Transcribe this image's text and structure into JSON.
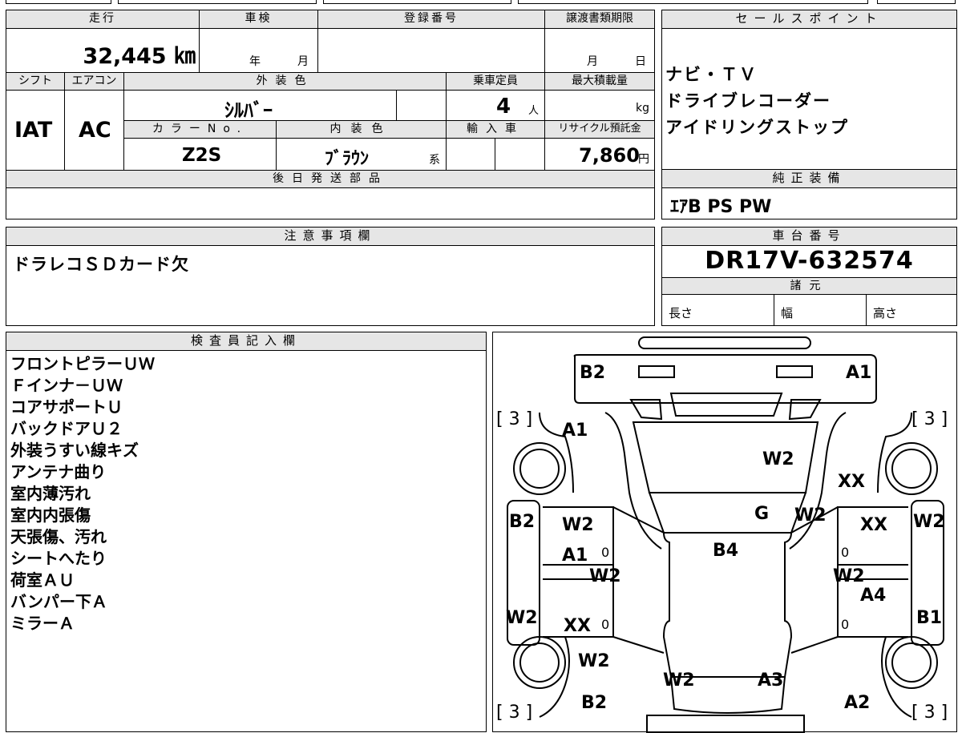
{
  "top_info": {
    "mileage_label": "走行",
    "mileage_value": "32,445 ㎞",
    "shaken_label": "車検",
    "shaken_year_unit": "年",
    "shaken_month_unit": "月",
    "reg_number_label": "登録番号",
    "transfer_docs_label": "譲渡書類期限",
    "transfer_month_unit": "月",
    "transfer_day_unit": "日",
    "shift_label": "シフト",
    "shift_value": "IAT",
    "aircon_label": "エアコン",
    "aircon_value": "AC",
    "exterior_color_label": "外装色",
    "exterior_color_value": "ｼﾙﾊﾞｰ",
    "capacity_label": "乗車定員",
    "capacity_value": "4",
    "capacity_unit": "人",
    "max_load_label": "最大積載量",
    "max_load_unit": "kg",
    "color_no_label": "カラーNo.",
    "color_no_value": "Z2S",
    "interior_color_label": "内装色",
    "interior_color_value": "ﾌﾞﾗｳﾝ",
    "interior_color_suffix": "系",
    "import_label": "輸入車",
    "recycle_label": "リサイクル預託金",
    "recycle_value": "7,860",
    "recycle_unit": "円",
    "later_parts_label": "後日発送部品"
  },
  "sales_points": {
    "label": "セールスポイント",
    "items": [
      "ナビ・ＴＶ",
      "ドライブレコーダー",
      "アイドリングストップ"
    ]
  },
  "factory_equipment": {
    "label": "純正装備",
    "value": "ｴｱB PS PW"
  },
  "notes": {
    "label": "注意事項欄",
    "text": "ドラレコＳＤカード欠"
  },
  "chassis": {
    "label": "車台番号",
    "value": "DR17V-632574",
    "spec_label": "諸元",
    "length_label": "長さ",
    "width_label": "幅",
    "height_label": "高さ"
  },
  "inspector": {
    "label": "検査員記入欄",
    "items": [
      "フロントピラーＵＷ",
      "Ｆインナ－ＵＷ",
      "コアサポートＵ",
      "バックドアＵ２",
      "外装うすい線キズ",
      "アンテナ曲り",
      "室内薄汚れ",
      "室内内張傷",
      "天張傷、汚れ",
      "シートへたり",
      "荷室ＡＵ",
      "バンパー下Ａ",
      "ミラーＡ"
    ]
  },
  "diagram": {
    "labels": {
      "b2_rear": "B2",
      "a1_rear": "A1",
      "tire_rear_left": "[ 3 ]",
      "tire_rear_right": "[ 3 ]",
      "a1_left_upper": "A1",
      "w2_roof": "W2",
      "xx_right_upper": "XX",
      "b2_left_side": "B2",
      "w2_left_door1": "W2",
      "g_center": "G",
      "w2_right_upper": "W2",
      "xx_right_door1": "XX",
      "w2_right_side": "W2",
      "b4_center": "B4",
      "a1_left_door": "A1",
      "w2_left_mid": "W2",
      "w2_right_mid": "W2",
      "a4_right": "A4",
      "w2_left_side": "W2",
      "xx_left_door2": "XX",
      "b1_right_side": "B1",
      "w2_left_front": "W2",
      "w2_hood": "W2",
      "a3_hood": "A3",
      "b2_front": "B2",
      "a2_front": "A2",
      "tire_front_left": "[ 3 ]",
      "tire_front_right": "[ 3 ]",
      "zero_1": "0",
      "zero_2": "0",
      "zero_3": "0",
      "zero_4": "0"
    }
  }
}
